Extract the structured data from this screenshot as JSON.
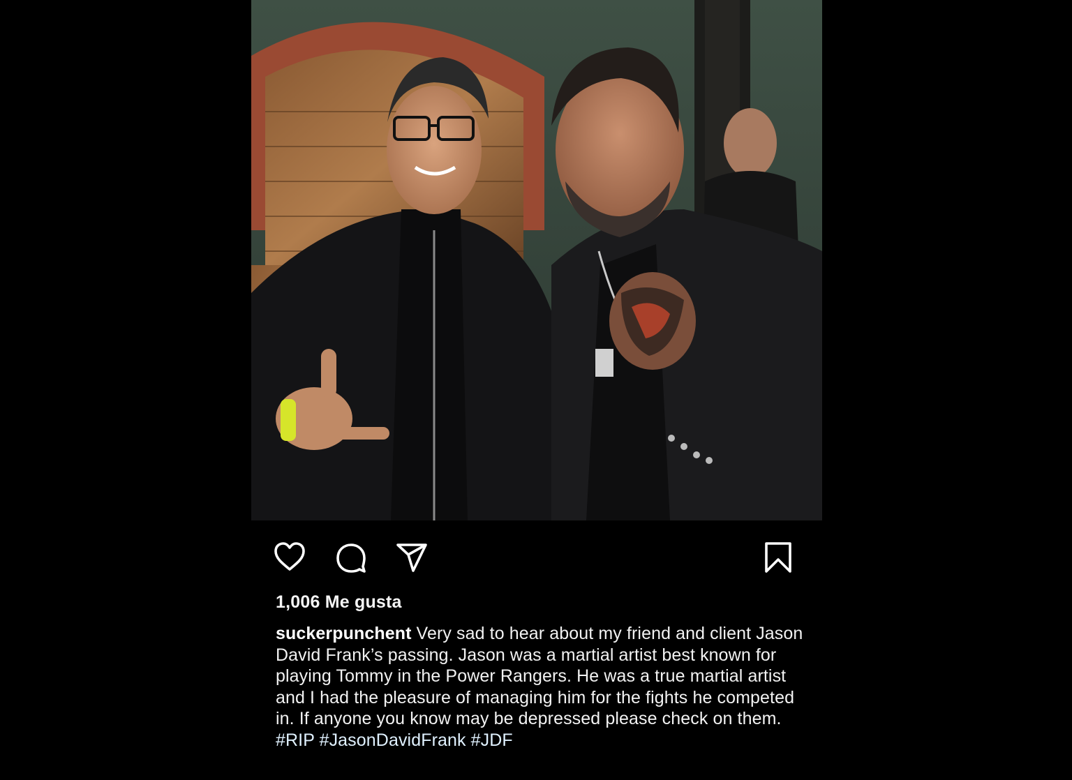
{
  "post": {
    "photo": {
      "alt_subject": "two-men-portrait"
    },
    "actions": {
      "like_icon": "heart-icon",
      "comment_icon": "comment-icon",
      "share_icon": "send-icon",
      "save_icon": "bookmark-icon"
    },
    "likes_text": "1,006 Me gusta",
    "caption": {
      "username": "suckerpunchent",
      "text": " Very sad to hear about my friend and client Jason David Frank’s passing. Jason was a martial artist best known for playing Tommy in the Power Rangers. He was a true martial artist and I had the pleasure of managing him for the fights he competed in. If anyone you know may be depressed please check on them. ",
      "hashtags": [
        "#RIP",
        "#JasonDavidFrank",
        "#JDF"
      ]
    },
    "colors": {
      "background": "#000000",
      "text": "#f2f2f2",
      "icon": "#ffffff"
    }
  }
}
